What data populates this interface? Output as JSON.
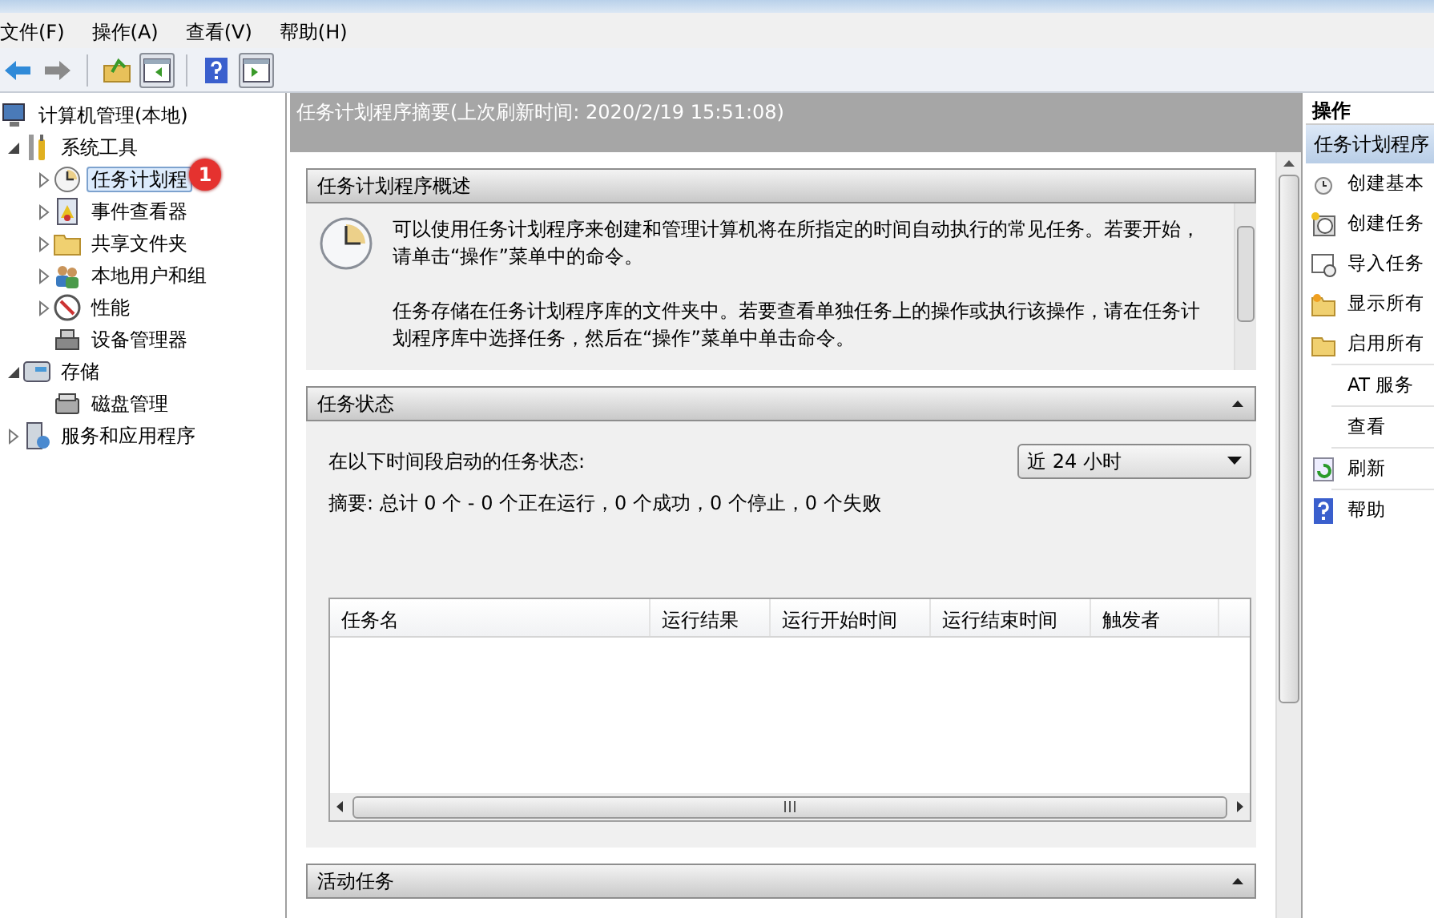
{
  "menu": [
    {
      "label": "文件(F)"
    },
    {
      "label": "操作(A)"
    },
    {
      "label": "查看(V)"
    },
    {
      "label": "帮助(H)"
    }
  ],
  "tree": [
    {
      "label": "计算机管理(本地)",
      "kind": "computer",
      "selected": false,
      "children": [
        {
          "label": "系统工具",
          "kind": "tools",
          "selected": false,
          "expanded": true,
          "children": [
            {
              "label": "任务计划程",
              "kind": "clock",
              "selected": true,
              "expanded": false,
              "badge": "1"
            },
            {
              "label": "事件查看器",
              "kind": "log",
              "selected": false,
              "expanded": false
            },
            {
              "label": "共享文件夹",
              "kind": "folder",
              "selected": false,
              "expanded": false
            },
            {
              "label": "本地用户和组",
              "kind": "users",
              "selected": false,
              "expanded": false
            },
            {
              "label": "性能",
              "kind": "gauge",
              "selected": false,
              "expanded": false
            },
            {
              "label": "设备管理器",
              "kind": "device",
              "selected": false
            }
          ]
        },
        {
          "label": "存储",
          "kind": "storage",
          "selected": false,
          "expanded": true,
          "children": [
            {
              "label": "磁盘管理",
              "kind": "disk",
              "selected": false
            }
          ]
        },
        {
          "label": "服务和应用程序",
          "kind": "services",
          "selected": false,
          "expanded": false
        }
      ]
    }
  ],
  "summary": {
    "title": "任务计划程序摘要(上次刷新时间: 2020/2/19 15:51:08)",
    "overview": {
      "title": "任务计划程序概述",
      "paragraphs": [
        "可以使用任务计划程序来创建和管理计算机将在所指定的时间自动执行的常见任务。若要开始，请单击“操作”菜单中的命令。",
        "任务存储在任务计划程序库的文件夹中。若要查看单独任务上的操作或执行该操作，请在任务计划程序库中选择任务，然后在“操作”菜单中单击命令。"
      ]
    },
    "status": {
      "title": "任务状态",
      "period_label": "在以下时间段启动的任务状态:",
      "period": "近 24 小时",
      "totals": "摘要: 总计 0 个 - 0 个正在运行，0 个成功，0 个停止，0 个失败",
      "columns": [
        "任务名",
        "运行结果",
        "运行开始时间",
        "运行结束时间",
        "触发者"
      ]
    },
    "active": {
      "title": "活动任务"
    }
  },
  "actions": {
    "title": "操作",
    "group": "任务计划程序",
    "items": [
      {
        "label": "创建基本",
        "kind": "small-clock",
        "separated": false
      },
      {
        "label": "创建任务",
        "kind": "new-clock",
        "separated": false
      },
      {
        "label": "导入任务",
        "kind": "import",
        "separated": false
      },
      {
        "label": "显示所有",
        "kind": "folder-star",
        "separated": false
      },
      {
        "label": "启用所有",
        "kind": "folder",
        "separated": false
      },
      {
        "label": "AT 服务",
        "kind": "none",
        "separated": true
      },
      {
        "label": "查看",
        "kind": "none",
        "separated": true
      },
      {
        "label": "刷新",
        "kind": "refresh",
        "separated": true
      },
      {
        "label": "帮助",
        "kind": "help",
        "separated": true
      }
    ]
  }
}
